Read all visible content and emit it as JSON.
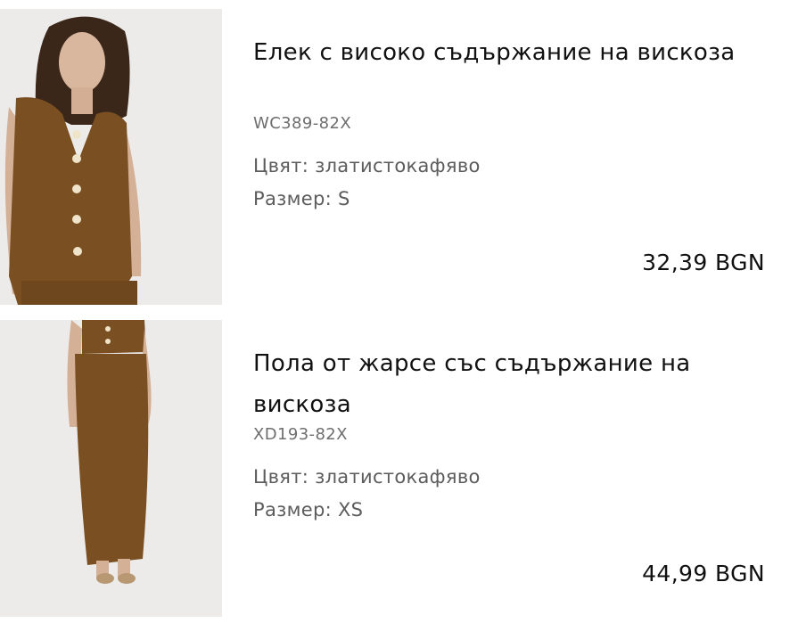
{
  "cart": {
    "items": [
      {
        "image_icon": "vest-product-photo",
        "title": "Елек с високо съдържание на вискоза",
        "sku": "WC389-82X",
        "color_label": "Цвят:",
        "color_value": "златистокафяво",
        "size_label": "Размер:",
        "size_value": "S",
        "price": "32,39 BGN"
      },
      {
        "image_icon": "skirt-product-photo",
        "title": "Пола от жарсе със съдържание на вискоза",
        "sku": "XD193-82X",
        "color_label": "Цвят:",
        "color_value": "златистокафяво",
        "size_label": "Размер:",
        "size_value": "XS",
        "price": "44,99 BGN"
      }
    ]
  },
  "colors": {
    "garment": "#7a4f22",
    "background": "#ecebe9",
    "text": "#111111",
    "muted_text": "#5c5c5c"
  }
}
